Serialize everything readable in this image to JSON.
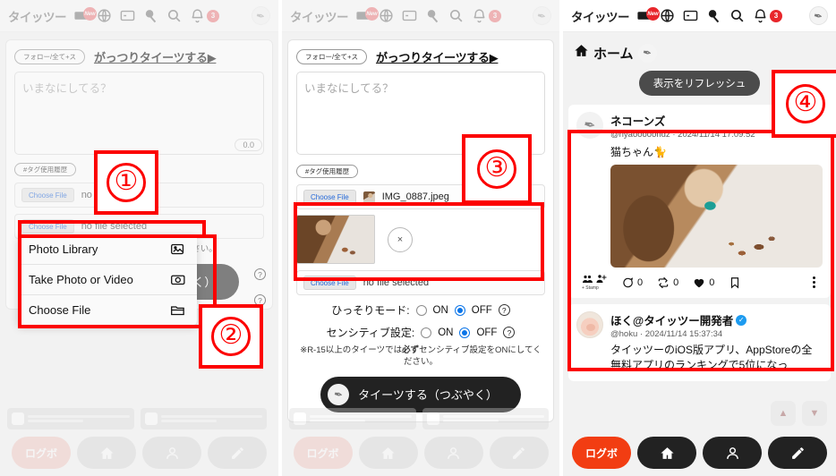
{
  "app": {
    "brand": "タイッツー",
    "header_icons": [
      "ticket-icon",
      "globe-icon",
      "card-icon",
      "table-tennis-icon",
      "search-icon",
      "bell-icon"
    ],
    "new_badge": "New",
    "notification_count": "3"
  },
  "composer": {
    "scope_pill": "フォロー/全て+ス",
    "full_compose_link": "がっつりタイーツする▶",
    "textarea_placeholder": "いまなにしてる？",
    "char_counter": "0.0",
    "tag_history": "#タグ使用履歴",
    "choose_file_label": "Choose File",
    "no_file_selected": "no file selected",
    "selected_file": "IMG_0887.jpeg",
    "remove_image": "×",
    "submit_label": "タイーツする（つぶやく）",
    "options": [
      {
        "label": "ひっそりモード:",
        "on": "ON",
        "off": "OFF",
        "selected": "OFF"
      },
      {
        "label": "センシティブ設定:",
        "on": "ON",
        "off": "OFF",
        "selected": "OFF"
      }
    ],
    "note_prefix": "※R-15以上のタイーツでは",
    "note_bold": "必ず",
    "note_suffix": "センシティブ設定をONにしてください。",
    "help_symbol": "?"
  },
  "action_sheet": {
    "items": [
      {
        "label": "Photo Library",
        "icon": "photo-library-icon"
      },
      {
        "label": "Take Photo or Video",
        "icon": "camera-icon"
      },
      {
        "label": "Choose File",
        "icon": "folder-icon"
      }
    ]
  },
  "home": {
    "title": "ホーム",
    "refresh_label": "表示をリフレッシュ",
    "posts": [
      {
        "name": "ネコーンズ",
        "handle": "@nyaooooondz",
        "separator": "·",
        "timestamp": "2024/11/14 17:09:52",
        "text": "猫ちゃん🐈",
        "has_image": true,
        "verified": false,
        "stamp_label": "+ Stamp",
        "reply_count": "0",
        "repost_count": "0",
        "like_count": "0"
      },
      {
        "name": "ほく@タイッツー開発者",
        "handle": "@hoku",
        "separator": "·",
        "timestamp": "2024/11/14 15:37:34",
        "text": "タイッツーのiOS版アプリ、AppStoreの全無料アプリのランキングで5位になっ",
        "has_image": false,
        "verified": true,
        "verified_mark": "✓"
      }
    ],
    "scroll_up": "▲",
    "scroll_down": "▼"
  },
  "bottom_nav": {
    "items": [
      {
        "label": "ログボ",
        "icon": "logbo-text",
        "accent": "#f23d12"
      },
      {
        "label": "",
        "icon": "home-icon"
      },
      {
        "label": "",
        "icon": "person-icon"
      },
      {
        "label": "",
        "icon": "pencil-icon"
      }
    ]
  },
  "annotations": {
    "markers": [
      "①",
      "②",
      "③",
      "④"
    ]
  },
  "colors": {
    "annotation_red": "#fc0000",
    "accent_red": "#e8262b",
    "radio_blue": "#0a74e8",
    "verified_blue": "#1d9bf0",
    "dark_button": "#222222"
  }
}
